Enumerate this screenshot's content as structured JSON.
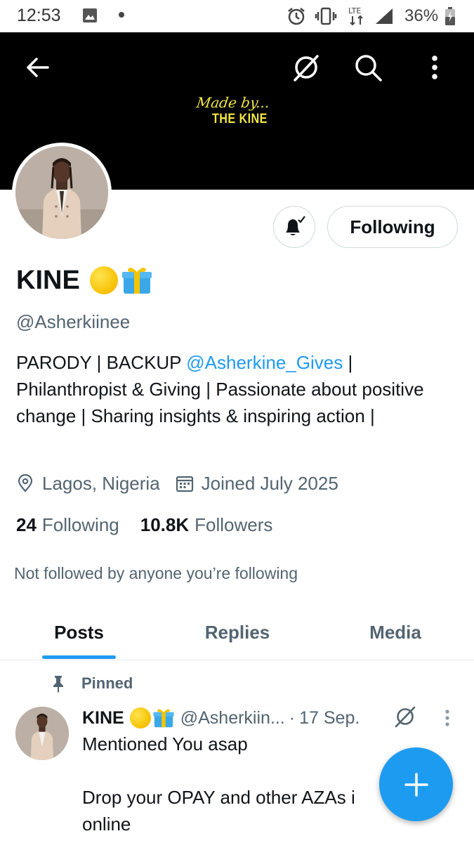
{
  "status_bar": {
    "time": "12:53",
    "network": "LTE",
    "battery": "36%"
  },
  "banner": {
    "logo_line1": "Made by...",
    "logo_line2": "THE KINE",
    "logo_color": "#f3e844"
  },
  "profile": {
    "display_name": "KINE",
    "name_emojis": [
      "yellow-circle-emoji",
      "gift-emoji"
    ],
    "handle": "@Asherkiinee",
    "bio_prefix": "PARODY | BACKUP ",
    "bio_mention": "@Asherkine_Gives",
    "bio_suffix": " | Philanthropist & Giving | Passionate about positive change | Sharing insights & inspiring action |",
    "location": "Lagos, Nigeria",
    "joined": "Joined July 2025",
    "following_count": "24",
    "following_label": "Following",
    "followers_count": "10.8K",
    "followers_label": "Followers",
    "not_followed_text": "Not followed by anyone you’re following"
  },
  "actions": {
    "notifications_icon": "bell-check-icon",
    "follow_button_label": "Following"
  },
  "tabs": [
    {
      "label": "Posts",
      "active": true
    },
    {
      "label": "Replies",
      "active": false
    },
    {
      "label": "Media",
      "active": false
    }
  ],
  "pinned_post": {
    "pinned_label": "Pinned",
    "author_name": "KINE",
    "author_handle": "@Asherkiin...",
    "separator": "·",
    "date": "17 Sep.",
    "text_line1": "Mentioned You asap",
    "text_line2": "Drop your OPAY and other AZAs i",
    "text_line3": "online"
  },
  "colors": {
    "accent": "#1d9bf0",
    "text_primary": "#0f1419",
    "text_secondary": "#536471",
    "border": "#cfd9de"
  }
}
